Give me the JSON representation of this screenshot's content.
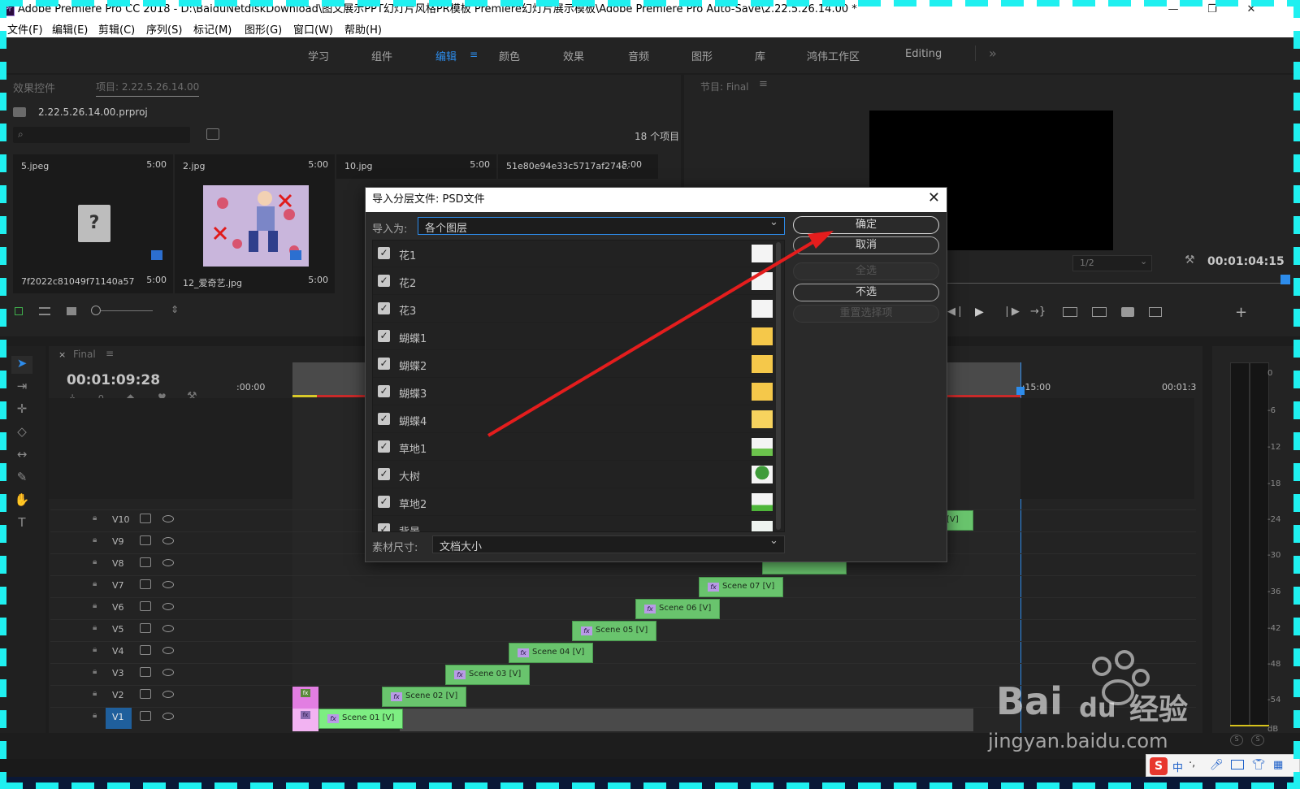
{
  "window": {
    "title": "Adobe Premiere Pro CC 2018 - D:\\BaiduNetdiskDownload\\图文展示PPT幻灯片风格PR模板 Premiere幻灯片展示模板\\Adobe Premiere Pro Auto-Save\\2.22.5.26.14.00 *",
    "logo": "Pr",
    "minimize": "—",
    "restore": "❐",
    "close": "✕"
  },
  "menu": [
    "文件(F)",
    "编辑(E)",
    "剪辑(C)",
    "序列(S)",
    "标记(M)",
    "图形(G)",
    "窗口(W)",
    "帮助(H)"
  ],
  "workspaces": [
    "学习",
    "组件",
    "编辑",
    "颜色",
    "效果",
    "音频",
    "图形",
    "库",
    "鸿伟工作区",
    "Editing"
  ],
  "workspace_more": "»",
  "project_panel": {
    "tab_effects": "效果控件",
    "tab_project": "项目: 2.22.5.26.14.00",
    "project_file": "2.22.5.26.14.00.prproj",
    "item_count": "18 个项目",
    "items": [
      {
        "name": "5.jpeg",
        "duration": "5:00"
      },
      {
        "name": "2.jpg",
        "duration": "5:00"
      },
      {
        "name": "10.jpg",
        "duration": "5:00"
      },
      {
        "name": "51e80e94e33c5717af274c...",
        "duration": "5:00"
      },
      {
        "name": "7f2022c81049f71140a5778...",
        "duration": "5:00"
      },
      {
        "name": "12_爱奇艺.jpg",
        "duration": "5:00"
      }
    ],
    "missing_glyph": "?"
  },
  "program_monitor": {
    "tab": "节目: Final",
    "zoom_select": "1/2",
    "timecode": "00:01:04:15"
  },
  "timeline": {
    "sequence_tab": "Final",
    "timecode": "00:01:09:28",
    "ruler_labels": [
      ":00:00",
      "00:01:15:00",
      "00:01:3"
    ],
    "tracks": [
      "V10",
      "V9",
      "V8",
      "V7",
      "V6",
      "V5",
      "V4",
      "V3",
      "V2",
      "V1"
    ],
    "clip_v10_label": "[V]",
    "clips": [
      {
        "label": "Scene 01 [V]"
      },
      {
        "label": "Scene 02 [V]"
      },
      {
        "label": "Scene 03 [V]"
      },
      {
        "label": "Scene 04 [V]"
      },
      {
        "label": "Scene 05 [V]"
      },
      {
        "label": "Scene 06 [V]"
      },
      {
        "label": "Scene 07 [V]"
      }
    ],
    "fx": "fx"
  },
  "audio_meter": {
    "labels": [
      "0",
      "-6",
      "-12",
      "-18",
      "-24",
      "-30",
      "-36",
      "-42",
      "-48",
      "-54",
      "dB"
    ],
    "solo": [
      "S",
      "S"
    ]
  },
  "dialog": {
    "title": "导入分层文件: PSD文件",
    "close": "✕",
    "import_as_label": "导入为:",
    "import_as_value": "各个图层",
    "layers": [
      "花1",
      "花2",
      "花3",
      "蝴蝶1",
      "蝴蝶2",
      "蝴蝶3",
      "蝴蝶4",
      "草地1",
      "大树",
      "草地2",
      "背景"
    ],
    "footage_size_label": "素材尺寸:",
    "footage_size_value": "文档大小",
    "buttons": {
      "ok": "确定",
      "cancel": "取消",
      "select_all": "全选",
      "select_none": "不选",
      "reset": "重置选择项"
    },
    "check": "✓",
    "chevron": "⌄"
  },
  "watermark": {
    "brand": "Bai",
    "brand2": "du",
    "brand3": "经验",
    "url": "jingyan.baidu.com"
  },
  "ime": {
    "label": "中",
    "dot": "·,"
  },
  "colors": {
    "accent": "#2d8ceb",
    "clip_green": "#69c46d",
    "arrow_red": "#e41d1d",
    "highlight_cyan": "#1ff0f0"
  }
}
